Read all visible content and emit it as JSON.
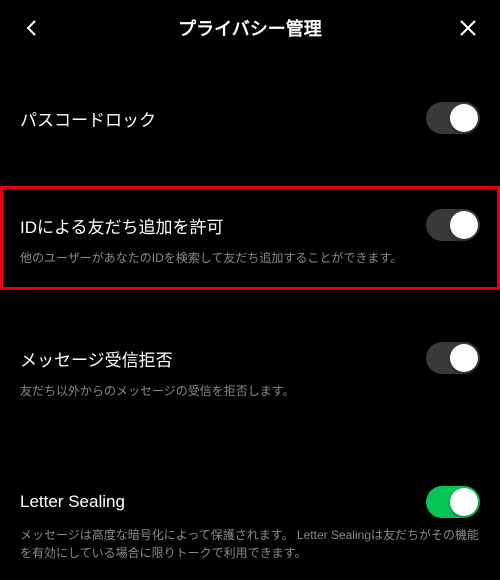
{
  "header": {
    "title": "プライバシー管理"
  },
  "sections": {
    "passcode": {
      "label": "パスコードロック",
      "state": "off"
    },
    "idAdd": {
      "label": "IDによる友だち追加を許可",
      "description": "他のユーザーがあなたのIDを検索して友だち追加することができます。",
      "state": "off"
    },
    "messageReject": {
      "label": "メッセージ受信拒否",
      "description": "友だち以外からのメッセージの受信を拒否します。",
      "state": "off"
    },
    "letterSealing": {
      "label": "Letter Sealing",
      "description": "メッセージは高度な暗号化によって保護されます。 Letter Sealingは友だちがその機能を有効にしている場合に限りトークで利用できます。",
      "state": "on"
    }
  }
}
